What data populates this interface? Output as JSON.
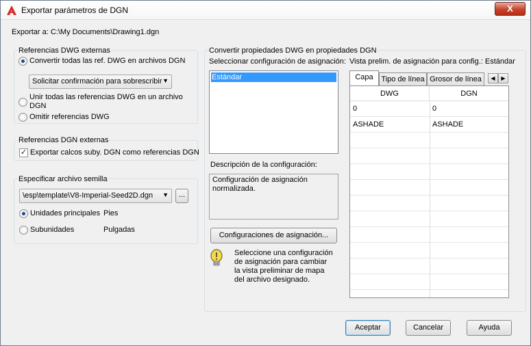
{
  "window": {
    "title": "Exportar parámetros de DGN",
    "close_label": "X"
  },
  "export_path": "Exportar a: C:\\My Documents\\Drawing1.dgn",
  "dwg_refs": {
    "title": "Referencias DWG externas",
    "option_convert": "Convertir todas las ref. DWG en archivos DGN",
    "overwrite_combo": "Solicitar confirmación para sobrescribir",
    "option_merge_line1": "Unir todas las referencias DWG en un archivo",
    "option_merge_line2": "DGN",
    "option_omit": "Omitir referencias DWG",
    "selected": "convert"
  },
  "dgn_refs": {
    "title": "Referencias DGN externas",
    "export_underlays": "Exportar calcos suby. DGN como referencias DGN",
    "export_underlays_checked": true
  },
  "seed": {
    "title": "Especificar archivo semilla",
    "file_combo": "\\esp\\template\\V8-Imperial-Seed2D.dgn",
    "browse_label": "...",
    "main_units_label": "Unidades principales",
    "main_units_value": "Pies",
    "sub_units_label": "Subunidades",
    "sub_units_value": "Pulgadas",
    "selected": "main"
  },
  "mapping": {
    "section_title": "Convertir propiedades DWG en propiedades DGN",
    "select_label": "Seleccionar configuración de asignación:",
    "setups": [
      "Estándar"
    ],
    "description_label": "Descripción de la configuración:",
    "description_line1": "Configuración de asignación",
    "description_line2": "normalizada.",
    "setups_button": "Configuraciones de asignación...",
    "tip_line1": "Seleccione una configuración",
    "tip_line2": "de asignación para cambiar",
    "tip_line3": "la vista preliminar de mapa",
    "tip_line4": "del archivo designado.",
    "preview_label": "Vista prelim. de asignación para config.: Estándar",
    "tabs": [
      "Capa",
      "Tipo de línea",
      "Grosor de línea"
    ],
    "active_tab": "Capa",
    "columns": [
      "DWG",
      "DGN"
    ],
    "rows": [
      [
        "0",
        "0"
      ],
      [
        "ASHADE",
        "ASHADE"
      ]
    ]
  },
  "buttons": {
    "accept": "Aceptar",
    "cancel": "Cancelar",
    "help": "Ayuda"
  },
  "colors": {
    "accent": "#3399ff",
    "close": "#c7432b",
    "tip_icon": "#f5d94a"
  }
}
